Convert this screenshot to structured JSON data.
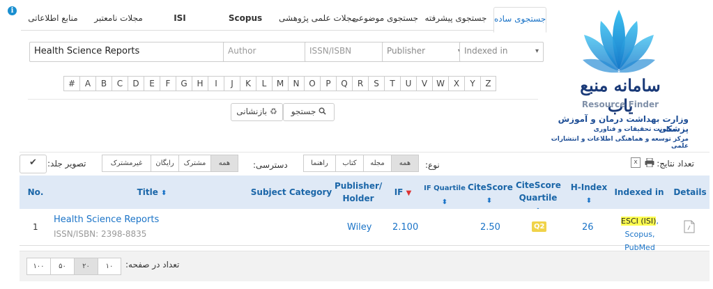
{
  "tabs": [
    "جستجوی ساده",
    "جستجوی پیشرفته",
    "جستجوی موضوعی",
    "مجلات علمی پژوهشی",
    "Scopus",
    "ISI",
    "مجلات نامعتبر",
    "منابع اطلاعاتی"
  ],
  "search": {
    "title_value": "Health Science Reports",
    "author_placeholder": "Author",
    "issn_placeholder": "ISSN/ISBN",
    "publisher_selected": "Publisher",
    "indexed_selected": "Indexed in",
    "letters": [
      "#",
      "A",
      "B",
      "C",
      "D",
      "E",
      "F",
      "G",
      "H",
      "I",
      "J",
      "K",
      "L",
      "M",
      "N",
      "O",
      "P",
      "Q",
      "R",
      "S",
      "T",
      "U",
      "V",
      "W",
      "X",
      "Y",
      "Z"
    ],
    "search_button": "جستجو",
    "reset_button": "بازنشانی"
  },
  "logo": {
    "title": "سامانه منبع یاب",
    "subtitle": "Resource Finder",
    "org_line1": "وزارت بهداشت درمان و آموزش پزشکی",
    "org_line2": "معاونت تحقیقات و فناوری",
    "org_line3": "مرکز توسعه و هماهنگی اطلاعات و انتشارات علمی"
  },
  "filters": {
    "results_label": "تعداد نتایج: ۱",
    "type_label": "نوع:",
    "type_options": [
      "همه",
      "مجله",
      "کتاب",
      "راهنما"
    ],
    "access_label": "دسترسی:",
    "access_options": [
      "همه",
      "مشترک",
      "رایگان",
      "غیرمشترک"
    ],
    "cover_label": "تصویر جلد:"
  },
  "table": {
    "headers": {
      "no": "No.",
      "title": "Title",
      "subject": "Subject Category",
      "publisher": "Publisher/ Holder",
      "if": "IF",
      "if_quartile": "IF Quartile",
      "citescore": "CiteScore",
      "citescore_quartile": "CiteScore Quartile",
      "hindex": "H-Index",
      "indexed": "Indexed in",
      "details": "Details"
    },
    "rows": [
      {
        "no": "1",
        "title": "Health Science Reports",
        "issn": "ISSN/ISBN: 2398-8835",
        "publisher": "Wiley",
        "if": "2.100",
        "citescore": "2.50",
        "cs_quartile": "Q2",
        "hindex": "26",
        "indexed_hl": "ESCI (ISI)",
        "indexed_rest1": ", Scopus,",
        "indexed_rest2": "PubMed"
      }
    ]
  },
  "pagination": {
    "label": "تعداد در صفحه:",
    "options": [
      "۱۰",
      "۲۰",
      "۵۰",
      "۱۰۰"
    ]
  },
  "colors": {
    "accent": "#1a73c7",
    "header_bg": "#dfe9f6",
    "highlight": "#ffff50",
    "quartile": "#f0d34a"
  }
}
